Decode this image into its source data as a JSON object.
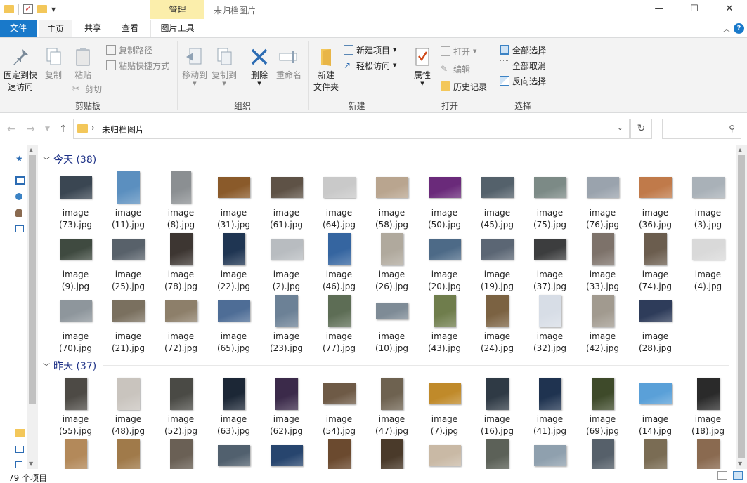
{
  "window": {
    "context_tab": "管理",
    "title": "未归档图片",
    "controls": {
      "minimize": "—",
      "maximize": "☐",
      "close": "✕"
    }
  },
  "tabs": {
    "file": "文件",
    "home": "主页",
    "share": "共享",
    "view": "查看",
    "picture_tools": "图片工具"
  },
  "ribbon": {
    "clipboard": {
      "label": "剪贴板",
      "pin": "固定到快速访问",
      "pin_line1": "固定到快",
      "pin_line2": "速访问",
      "copy": "复制",
      "paste": "粘贴",
      "copy_path": "复制路径",
      "paste_shortcut": "粘贴快捷方式",
      "cut": "剪切"
    },
    "organize": {
      "label": "组织",
      "move_to": "移动到",
      "copy_to": "复制到",
      "delete": "删除",
      "rename": "重命名"
    },
    "new": {
      "label": "新建",
      "new_folder_line1": "新建",
      "new_folder_line2": "文件夹",
      "new_item": "新建项目",
      "easy_access": "轻松访问"
    },
    "open": {
      "label": "打开",
      "properties": "属性",
      "open": "打开",
      "edit": "编辑",
      "history": "历史记录"
    },
    "select": {
      "label": "选择",
      "select_all": "全部选择",
      "select_none": "全部取消",
      "invert": "反向选择"
    }
  },
  "address": {
    "path": "未归档图片"
  },
  "groups": [
    {
      "header": "今天 (38)",
      "items": [
        {
          "l1": "image",
          "l2": "(73).jpg",
          "c": "#3a4652",
          "w": 46,
          "h": 32
        },
        {
          "l1": "image",
          "l2": "(11).jpg",
          "c": "#5b8fbf",
          "w": 32,
          "h": 46
        },
        {
          "l1": "image",
          "l2": "(8).jpg",
          "c": "#8b8f92",
          "w": 28,
          "h": 46
        },
        {
          "l1": "image",
          "l2": "(31).jpg",
          "c": "#8a5a2a",
          "w": 46,
          "h": 30
        },
        {
          "l1": "image",
          "l2": "(61).jpg",
          "c": "#5e5246",
          "w": 46,
          "h": 30
        },
        {
          "l1": "image",
          "l2": "(64).jpg",
          "c": "#c9c9c9",
          "w": 46,
          "h": 30
        },
        {
          "l1": "image",
          "l2": "(58).jpg",
          "c": "#b9a58f",
          "w": 46,
          "h": 30
        },
        {
          "l1": "image",
          "l2": "(50).jpg",
          "c": "#6a2a7a",
          "w": 46,
          "h": 30
        },
        {
          "l1": "image",
          "l2": "(45).jpg",
          "c": "#54616b",
          "w": 46,
          "h": 30
        },
        {
          "l1": "image",
          "l2": "(75).jpg",
          "c": "#7c8a86",
          "w": 46,
          "h": 30
        },
        {
          "l1": "image",
          "l2": "(76).jpg",
          "c": "#9aa3ad",
          "w": 46,
          "h": 30
        },
        {
          "l1": "image",
          "l2": "(36).jpg",
          "c": "#c07a4a",
          "w": 46,
          "h": 30
        },
        {
          "l1": "image",
          "l2": "(3).jpg",
          "c": "#a9b1b8",
          "w": 46,
          "h": 30
        },
        {
          "l1": "image",
          "l2": "(9).jpg",
          "c": "#3f4a40",
          "w": 46,
          "h": 30
        },
        {
          "l1": "image",
          "l2": "(25).jpg",
          "c": "#58616a",
          "w": 46,
          "h": 30
        },
        {
          "l1": "image",
          "l2": "(78).jpg",
          "c": "#3d3632",
          "w": 32,
          "h": 46
        },
        {
          "l1": "image",
          "l2": "(22).jpg",
          "c": "#1f3552",
          "w": 32,
          "h": 46
        },
        {
          "l1": "image",
          "l2": "(2).jpg",
          "c": "#b8bcc0",
          "w": 46,
          "h": 30
        },
        {
          "l1": "image",
          "l2": "(46).jpg",
          "c": "#3565a0",
          "w": 32,
          "h": 46
        },
        {
          "l1": "image",
          "l2": "(26).jpg",
          "c": "#b0a99d",
          "w": 32,
          "h": 46
        },
        {
          "l1": "image",
          "l2": "(20).jpg",
          "c": "#4d6a87",
          "w": 46,
          "h": 30
        },
        {
          "l1": "image",
          "l2": "(19).jpg",
          "c": "#5b6674",
          "w": 46,
          "h": 30
        },
        {
          "l1": "image",
          "l2": "(37).jpg",
          "c": "#3c3d3e",
          "w": 46,
          "h": 30
        },
        {
          "l1": "image",
          "l2": "(33).jpg",
          "c": "#7d726a",
          "w": 32,
          "h": 46
        },
        {
          "l1": "image",
          "l2": "(74).jpg",
          "c": "#6b5d4e",
          "w": 32,
          "h": 46
        },
        {
          "l1": "image",
          "l2": "(4).jpg",
          "c": "#d9d9d9",
          "w": 46,
          "h": 30
        },
        {
          "l1": "image",
          "l2": "(70).jpg",
          "c": "#8e969c",
          "w": 46,
          "h": 30
        },
        {
          "l1": "image",
          "l2": "(21).jpg",
          "c": "#7a705f",
          "w": 46,
          "h": 30
        },
        {
          "l1": "image",
          "l2": "(72).jpg",
          "c": "#8d7f6a",
          "w": 46,
          "h": 30
        },
        {
          "l1": "image",
          "l2": "(65).jpg",
          "c": "#4e6d96",
          "w": 46,
          "h": 30
        },
        {
          "l1": "image",
          "l2": "(23).jpg",
          "c": "#6c8196",
          "w": 32,
          "h": 46
        },
        {
          "l1": "image",
          "l2": "(77).jpg",
          "c": "#5d6d55",
          "w": 32,
          "h": 46
        },
        {
          "l1": "image",
          "l2": "(10).jpg",
          "c": "#7e8b96",
          "w": 46,
          "h": 24
        },
        {
          "l1": "image",
          "l2": "(43).jpg",
          "c": "#6f7d4c",
          "w": 32,
          "h": 46
        },
        {
          "l1": "image",
          "l2": "(24).jpg",
          "c": "#7b6242",
          "w": 32,
          "h": 46
        },
        {
          "l1": "image",
          "l2": "(32).jpg",
          "c": "#d7dde6",
          "w": 32,
          "h": 46
        },
        {
          "l1": "image",
          "l2": "(42).jpg",
          "c": "#a19a8f",
          "w": 32,
          "h": 46
        },
        {
          "l1": "image",
          "l2": "(28).jpg",
          "c": "#2e3c5a",
          "w": 46,
          "h": 30
        }
      ]
    },
    {
      "header": "昨天 (37)",
      "items": [
        {
          "l1": "image",
          "l2": "(55).jpg",
          "c": "#4d4a45",
          "w": 32,
          "h": 46
        },
        {
          "l1": "image",
          "l2": "(48).jpg",
          "c": "#c9c4be",
          "w": 32,
          "h": 46
        },
        {
          "l1": "image",
          "l2": "(52).jpg",
          "c": "#4a4a45",
          "w": 32,
          "h": 46
        },
        {
          "l1": "image",
          "l2": "(63).jpg",
          "c": "#1c2736",
          "w": 32,
          "h": 46
        },
        {
          "l1": "image",
          "l2": "(62).jpg",
          "c": "#3b2a4a",
          "w": 32,
          "h": 46
        },
        {
          "l1": "image",
          "l2": "(54).jpg",
          "c": "#6e5a46",
          "w": 46,
          "h": 30
        },
        {
          "l1": "image",
          "l2": "(47).jpg",
          "c": "#6e6250",
          "w": 32,
          "h": 46
        },
        {
          "l1": "image",
          "l2": "(7).jpg",
          "c": "#c08a2a",
          "w": 46,
          "h": 30
        },
        {
          "l1": "image",
          "l2": "(16).jpg",
          "c": "#2f3a45",
          "w": 32,
          "h": 46
        },
        {
          "l1": "image",
          "l2": "(41).jpg",
          "c": "#1f3350",
          "w": 32,
          "h": 46
        },
        {
          "l1": "image",
          "l2": "(69).jpg",
          "c": "#3e4a2a",
          "w": 32,
          "h": 46
        },
        {
          "l1": "image",
          "l2": "(14).jpg",
          "c": "#5aa0d8",
          "w": 46,
          "h": 30
        },
        {
          "l1": "image",
          "l2": "(18).jpg",
          "c": "#2a2a2a",
          "w": 32,
          "h": 46
        },
        {
          "l1": "",
          "l2": "",
          "c": "#b3895a",
          "w": 32,
          "h": 46
        },
        {
          "l1": "",
          "l2": "",
          "c": "#a07a4a",
          "w": 32,
          "h": 46
        },
        {
          "l1": "",
          "l2": "",
          "c": "#6a6055",
          "w": 32,
          "h": 46
        },
        {
          "l1": "",
          "l2": "",
          "c": "#51606e",
          "w": 46,
          "h": 30
        },
        {
          "l1": "",
          "l2": "",
          "c": "#27456e",
          "w": 46,
          "h": 30
        },
        {
          "l1": "",
          "l2": "",
          "c": "#6b4a2f",
          "w": 32,
          "h": 46
        },
        {
          "l1": "",
          "l2": "",
          "c": "#4a3a2a",
          "w": 32,
          "h": 46
        },
        {
          "l1": "",
          "l2": "",
          "c": "#c9b9a5",
          "w": 46,
          "h": 30
        },
        {
          "l1": "",
          "l2": "",
          "c": "#5c6158",
          "w": 32,
          "h": 46
        },
        {
          "l1": "",
          "l2": "",
          "c": "#8fa0ae",
          "w": 46,
          "h": 30
        },
        {
          "l1": "",
          "l2": "",
          "c": "#56606a",
          "w": 32,
          "h": 46
        },
        {
          "l1": "",
          "l2": "",
          "c": "#7a6c54",
          "w": 32,
          "h": 46
        },
        {
          "l1": "",
          "l2": "",
          "c": "#8a6a50",
          "w": 32,
          "h": 46
        }
      ]
    }
  ],
  "status": {
    "count": "79 个项目"
  }
}
